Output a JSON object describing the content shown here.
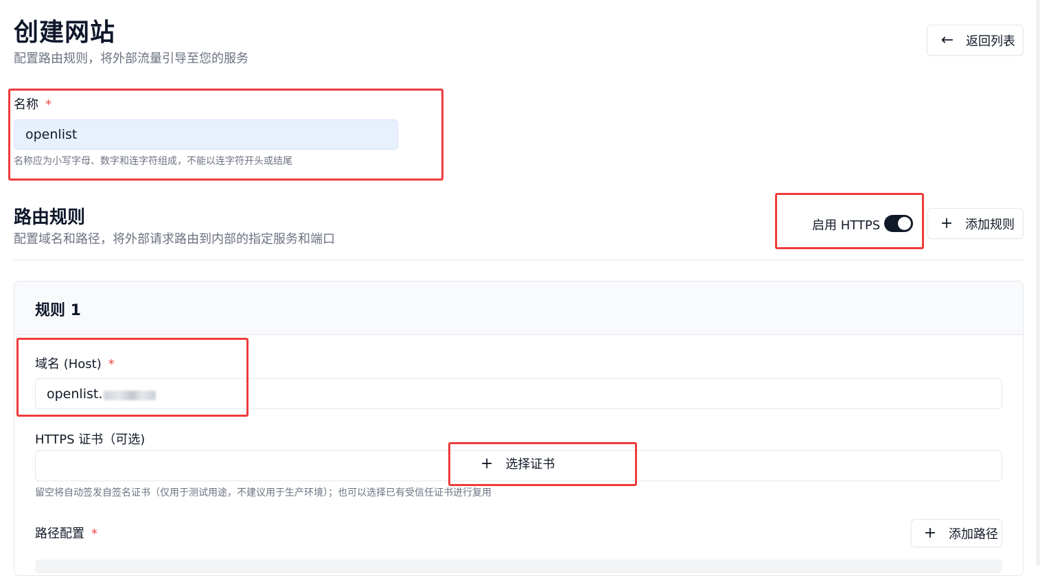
{
  "header": {
    "title": "创建网站",
    "subtitle": "配置路由规则，将外部流量引导至您的服务",
    "back_button": {
      "label": "返回列表",
      "icon": "arrow-left-icon"
    }
  },
  "name_field": {
    "label": "名称",
    "required_mark": "*",
    "value": "openlist",
    "hint": "名称应为小写字母、数字和连字符组成，不能以连字符开头或结尾"
  },
  "routing": {
    "title": "路由规则",
    "subtitle": "配置域名和路径，将外部请求路由到内部的指定服务和端口",
    "https_toggle": {
      "label": "启用 HTTPS",
      "checked": true
    },
    "add_rule_button": {
      "label": "添加规则",
      "icon": "plus-icon"
    }
  },
  "rule": {
    "title": "规则 1",
    "host": {
      "label": "域名 (Host)",
      "required_mark": "*",
      "value": "openlist."
    },
    "cert": {
      "label": "HTTPS 证书（可选)",
      "select_button": {
        "label": "选择证书",
        "icon": "plus-icon"
      },
      "hint": "留空将自动签发自签名证书（仅用于测试用途，不建议用于生产环境）；也可以选择已有受信任证书进行复用"
    },
    "paths": {
      "label": "路径配置",
      "required_mark": "*",
      "add_path_button": {
        "label": "添加路径",
        "icon": "plus-icon"
      }
    }
  },
  "colors": {
    "accent_dark": "#111827",
    "required": "#ef4444",
    "annotation_red": "#ef3b3b",
    "filled_input_bg": "#e8f0fe"
  }
}
